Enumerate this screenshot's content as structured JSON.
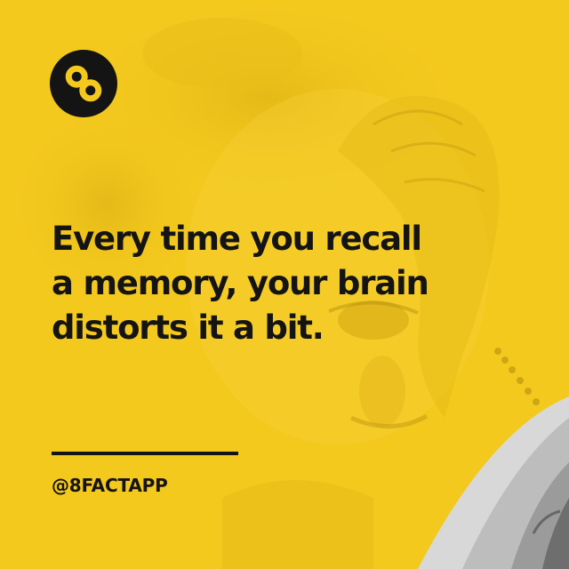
{
  "brand": {
    "logo_icon": "infinity-eight-icon",
    "background_color": "#f4c91e",
    "text_color": "#141414"
  },
  "fact": {
    "lines": [
      "Every time you recall",
      "a memory, your brain",
      "distorts it a bit."
    ]
  },
  "handle": "@8FACTAPP"
}
